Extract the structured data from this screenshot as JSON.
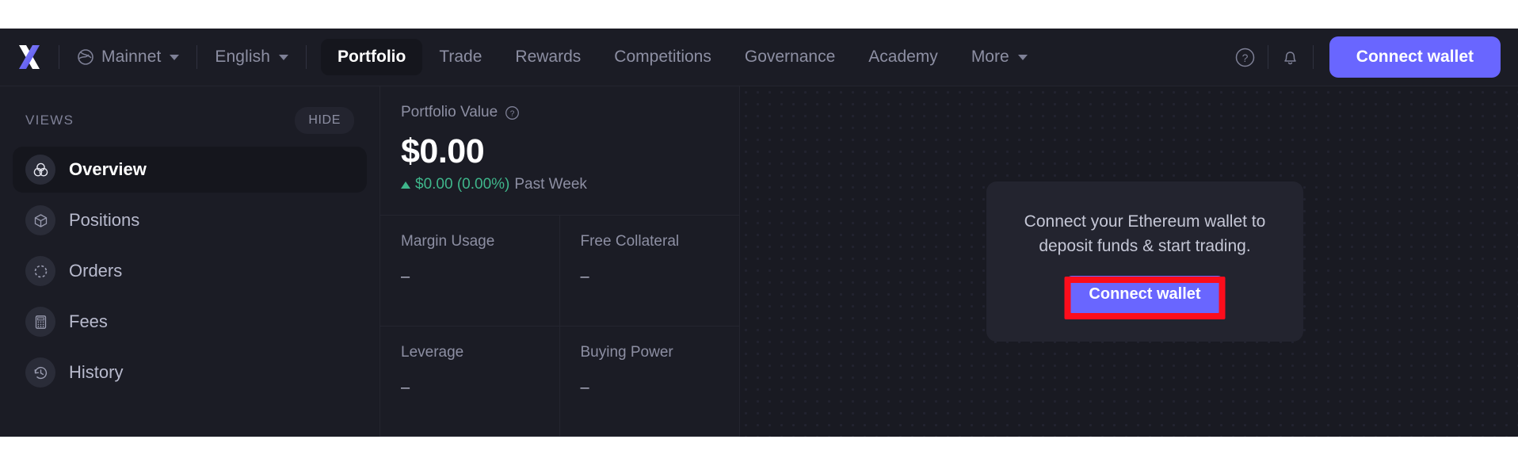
{
  "topnav": {
    "logo_name": "dydx-logo",
    "network": {
      "label": "Mainnet",
      "icon": "globe-icon"
    },
    "language": {
      "label": "English"
    },
    "links": [
      {
        "label": "Portfolio",
        "active": true
      },
      {
        "label": "Trade",
        "active": false
      },
      {
        "label": "Rewards",
        "active": false
      },
      {
        "label": "Competitions",
        "active": false
      },
      {
        "label": "Governance",
        "active": false
      },
      {
        "label": "Academy",
        "active": false
      },
      {
        "label": "More",
        "active": false,
        "caret": true
      }
    ],
    "help_icon": "help-circle-icon",
    "notifications_icon": "bell-icon",
    "connect_wallet_label": "Connect wallet"
  },
  "sidebar": {
    "section_label": "VIEWS",
    "hide_label": "HIDE",
    "items": [
      {
        "label": "Overview",
        "icon": "venn-circles-icon",
        "active": true
      },
      {
        "label": "Positions",
        "icon": "cube-icon",
        "active": false
      },
      {
        "label": "Orders",
        "icon": "dashed-circle-icon",
        "active": false
      },
      {
        "label": "Fees",
        "icon": "calculator-icon",
        "active": false
      },
      {
        "label": "History",
        "icon": "clock-rewind-icon",
        "active": false
      }
    ]
  },
  "portfolio": {
    "value_title": "Portfolio Value",
    "value_help_icon": "help-circle-icon",
    "value": "$0.00",
    "delta_amount": "$0.00 (0.00%)",
    "delta_period": "Past Week",
    "delta_direction": "up",
    "stats": [
      {
        "label": "Margin Usage",
        "value": "–"
      },
      {
        "label": "Free Collateral",
        "value": "–"
      },
      {
        "label": "Leverage",
        "value": "–"
      },
      {
        "label": "Buying Power",
        "value": "–"
      }
    ]
  },
  "connect_card": {
    "message": "Connect your Ethereum wallet to deposit funds & start trading.",
    "button_label": "Connect wallet"
  },
  "colors": {
    "app_background": "#1b1c25",
    "panel_background": "#191a22",
    "card_background": "#23242f",
    "accent": "#6966ff",
    "positive": "#3fb68b",
    "text_primary": "#ffffff",
    "text_muted": "#8d8fa3",
    "annotation": "#fc0d1c"
  }
}
